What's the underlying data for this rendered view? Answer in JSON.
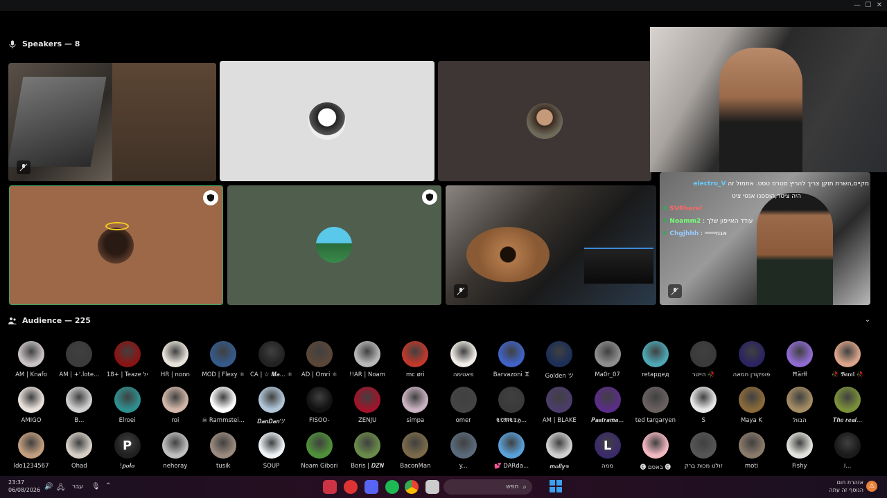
{
  "speakers": {
    "header": "Speakers — 8"
  },
  "audience": {
    "header": "Audience — 225",
    "rows": [
      [
        {
          "name": "AM | Knafo",
          "color": "#c9c2c4"
        },
        {
          "name": "AM | +'.lote...",
          "color": "#3b3b3b"
        },
        {
          "name": "18+ | Teaze יל",
          "color": "#8a1414"
        },
        {
          "name": "HR | nonn",
          "color": "#e8e3da"
        },
        {
          "name": "MOD | Flexy ⚛",
          "color": "#355a8a"
        },
        {
          "name": "CA | ☆ 𝑴𝒂... ⚛",
          "color": "#222"
        },
        {
          "name": "AD | Omri ⚛",
          "color": "#5a4638"
        },
        {
          "name": "!!AR | Noam",
          "color": "#b8b8b8"
        },
        {
          "name": "mc øri",
          "color": "#c0392b"
        },
        {
          "name": "פאטימה",
          "color": "#f0ece6"
        },
        {
          "name": "Barvazoni ♊",
          "color": "#3f63c6"
        },
        {
          "name": "Golden ツ",
          "color": "#1d2f57"
        },
        {
          "name": "Ma0r_07",
          "color": "#8d8d8d"
        },
        {
          "name": "retардед",
          "color": "#4ea7b4"
        },
        {
          "name": "הייטר 🥀",
          "color": "#3a3a3a"
        },
        {
          "name": "פופקורן חמאה",
          "color": "#2b2460"
        },
        {
          "name": "Ħärłł",
          "color": "#8e6bd1"
        },
        {
          "name": "🥀 𝕭𝖆𝖗𝖆𝖑 🥀",
          "color": "#d9a48a"
        }
      ],
      [
        {
          "name": "AMIGO",
          "color": "#e9e1db"
        },
        {
          "name": "B...",
          "color": "#cfcfcf"
        },
        {
          "name": "Elroei",
          "color": "#2f8f8f"
        },
        {
          "name": "roi",
          "color": "#d2b7a8"
        },
        {
          "name": "☠ Rammstei...",
          "color": "#fdfdfd"
        },
        {
          "name": "𝑫𝒂𝒏𝑫𝒂𝒏ツ",
          "color": "#b0c6d8"
        },
        {
          "name": "FISOO-",
          "color": "#111"
        },
        {
          "name": "ZENJU",
          "color": "#a0142a"
        },
        {
          "name": "simpa",
          "color": "#c9b3c0"
        },
        {
          "name": "omer",
          "color": "#444"
        },
        {
          "name": "𝕮𝕺𝕸𝕮𝕿𝕳...",
          "color": "#3a3a3a"
        },
        {
          "name": "AM | BLAKE",
          "color": "#4a3d6a"
        },
        {
          "name": "𝑷𝒂𝒔𝒕𝒓𝒂𝒎𝒂...",
          "color": "#5a2d86"
        },
        {
          "name": "ted targaryen",
          "color": "#6a6060"
        },
        {
          "name": "S",
          "color": "#e6e6e6"
        },
        {
          "name": "Maya K",
          "color": "#8a6a3a"
        },
        {
          "name": "הבוול",
          "color": "#a38b63"
        },
        {
          "name": "𝑻𝒉𝒆 𝒓𝒆𝒂𝒍...",
          "color": "#7a8f3a"
        }
      ],
      [
        {
          "name": "Ido1234567",
          "color": "#c29e7e"
        },
        {
          "name": "Ohad",
          "color": "#d6cfc6"
        },
        {
          "name": "!𝒑𝒐𝒍𝒐",
          "color": "#202020",
          "letter": "P"
        },
        {
          "name": "nehoray",
          "color": "#bfbfbf"
        },
        {
          "name": "tusik",
          "color": "#9b8a7e"
        },
        {
          "name": "SOUP",
          "color": "#eef3f7"
        },
        {
          "name": "Noam Gibori",
          "color": "#4f8f3a"
        },
        {
          "name": "Boris | 𝑫𝒁𝑵",
          "color": "#6a8a4a"
        },
        {
          "name": "BaconMan",
          "color": "#7a6a4a"
        },
        {
          "name": "y...",
          "color": "#5a6a7a"
        },
        {
          "name": "💕 DARda...",
          "color": "#5aa0d8"
        },
        {
          "name": "𝒎𝒐𝒍𝒍𝒚𖦹",
          "color": "#d0d0d0"
        },
        {
          "name": "ממה",
          "color": "#3b2a6a",
          "letter": "L"
        },
        {
          "name": "🅒 באסם 🅒",
          "color": "#f2b8c2"
        },
        {
          "name": "זולט מכות ברק",
          "color": "#555"
        },
        {
          "name": "moti",
          "color": "#8a7a6a"
        },
        {
          "name": "Fishy",
          "color": "#e2e2dd"
        },
        {
          "name": "i...",
          "color": "#1a1a1a"
        }
      ]
    ]
  },
  "chat": {
    "lines": [
      {
        "user": "electro_V",
        "text": "מקיים,השרת תוקן צריך להריץ סטרס טסט. אתמול זה",
        "color": "#6cf"
      },
      {
        "user": "",
        "text": "היה ציטר,הוספנו אנטי ציט",
        "color": "#fff"
      },
      {
        "user": "SVRharel",
        "text": "",
        "color": "#f66"
      },
      {
        "user": "Noamm2",
        "text": "עודד האייפון שלך",
        "color": "#7f7"
      },
      {
        "user": "Chgjhhh",
        "text": "אגמיייייייי",
        "color": "#9cf"
      }
    ]
  },
  "taskbar": {
    "time": "23:37",
    "date": "06/08/2026",
    "lang": "עבר",
    "search_placeholder": "חפש",
    "weather_title": "אזהרת חום",
    "weather_sub": "הנוסף זה עתה"
  },
  "colors": {
    "accent_green": "#3ba55d",
    "taskbar_bg": "#2a0e22"
  }
}
